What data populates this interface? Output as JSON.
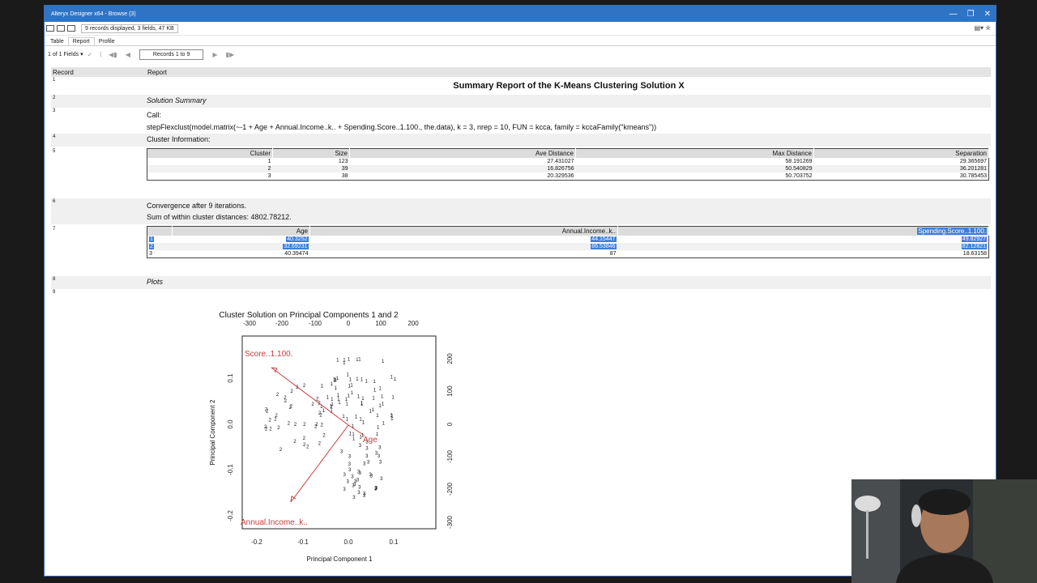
{
  "window": {
    "title": "Alteryx Designer x64 - Browse (3)"
  },
  "toolbar": {
    "status": "9 records displayed, 3 fields, 47 KB"
  },
  "tabs": [
    "Table",
    "Report",
    "Profile"
  ],
  "nav": {
    "fields": "1 of 1 Fields",
    "records": "Records 1 to 9"
  },
  "grid": {
    "col_record": "Record",
    "col_report": "Report",
    "row_numbers": [
      "1",
      "2",
      "3",
      "4",
      "5",
      "6",
      "7",
      "8",
      "9"
    ],
    "report_title": "Summary Report of the K-Means Clustering Solution X",
    "solution_summary": "Solution Summary",
    "call_label": "Call:",
    "call_text": "stepFlexclust(model.matrix(~-1 + Age + Annual.Income..k.. + Spending.Score..1.100., the.data), k = 3, nrep = 10, FUN = kcca, family = kccaFamily(\"kmeans\"))",
    "cluster_info": "Cluster Information:",
    "cluster_table": {
      "headers": [
        "Cluster",
        "Size",
        "Ave Distance",
        "Max Distance",
        "Separation"
      ],
      "rows": [
        [
          "1",
          "123",
          "27.431027",
          "58.191269",
          "29.365697"
        ],
        [
          "2",
          "39",
          "16.826756",
          "50.540829",
          "36.201281"
        ],
        [
          "3",
          "38",
          "20.329536",
          "50.703752",
          "30.785453"
        ]
      ]
    },
    "convergence": "Convergence after 9 iterations.",
    "within": "Sum of within cluster distances: 4802.78212.",
    "centroid_table": {
      "headers": [
        "",
        "Age",
        "Annual.Income..k..",
        "Spending.Score..1.100."
      ],
      "rows": [
        [
          "1",
          "40.3252",
          "44.15447",
          "49.82927"
        ],
        [
          "2",
          "32.69231",
          "86.53846",
          "82.12821"
        ],
        [
          "3",
          "40.39474",
          "87",
          "18.63158"
        ]
      ]
    },
    "plots": "Plots"
  },
  "plot": {
    "title": "Cluster Solution on Principal Components 1 and 2",
    "xlabel": "Principal Component 1",
    "ylabel": "Principal Component 2",
    "bottom_ticks": [
      "-0.2",
      "-0.1",
      "0.0",
      "0.1"
    ],
    "left_ticks": [
      "0.1",
      "0.0",
      "-0.1",
      "-0.2"
    ],
    "top_ticks": [
      "-300",
      "-200",
      "-100",
      "0",
      "100",
      "200"
    ],
    "right_ticks": [
      "200",
      "100",
      "0",
      "-100",
      "-200",
      "-300"
    ],
    "arrow_labels": [
      "Score..1.100.",
      "Age",
      "Annual.Income..k.."
    ],
    "arrow_color": "#c83c3c"
  }
}
